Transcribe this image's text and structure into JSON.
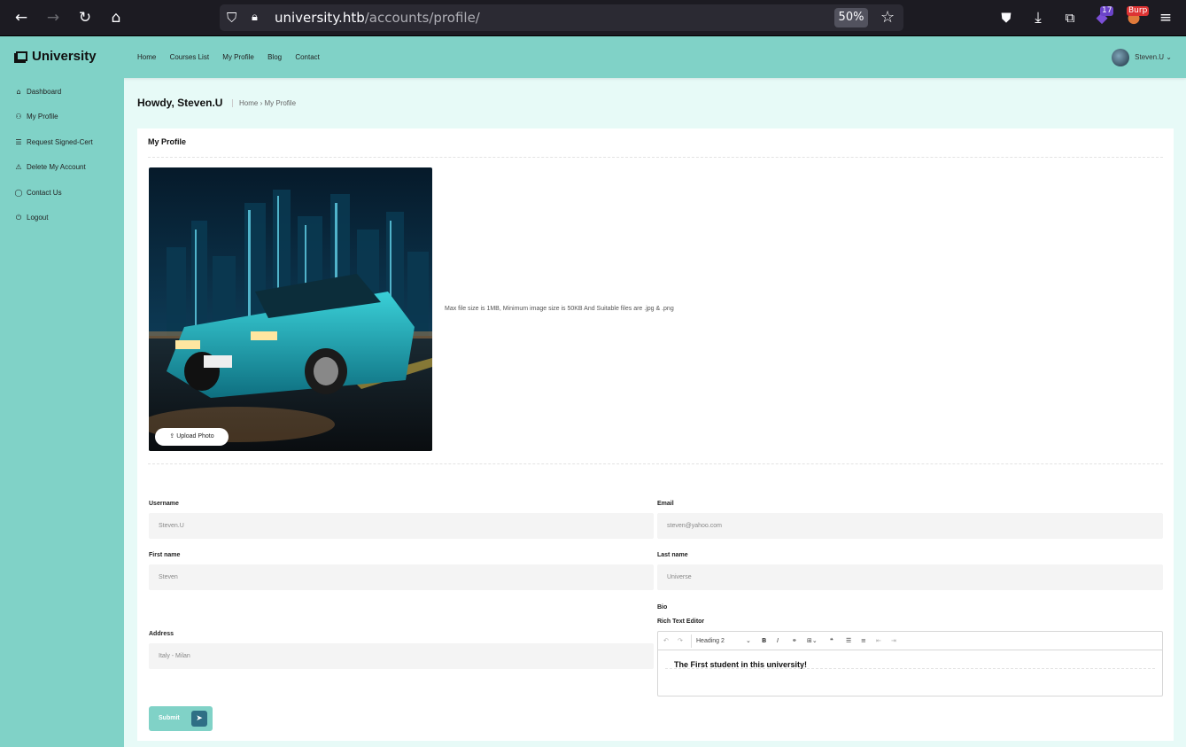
{
  "browser": {
    "url_host": "university.htb",
    "url_path": "/accounts/profile/",
    "zoom": "50%",
    "ext_badge_count": "17",
    "ext_badge_label": "Burp"
  },
  "header": {
    "logo": "University",
    "nav": [
      "Home",
      "Courses List",
      "My Profile",
      "Blog",
      "Contact"
    ],
    "user": "Steven.U"
  },
  "sidebar": {
    "items": [
      {
        "label": "Dashboard",
        "icon": "home-icon"
      },
      {
        "label": "My Profile",
        "icon": "user-icon"
      },
      {
        "label": "Request Signed-Cert",
        "icon": "document-icon"
      },
      {
        "label": "Delete My Account",
        "icon": "warning-icon"
      },
      {
        "label": "Contact Us",
        "icon": "chat-icon"
      },
      {
        "label": "Logout",
        "icon": "logout-icon"
      }
    ]
  },
  "page": {
    "greeting": "Howdy, Steven.U",
    "breadcrumb": [
      "Home",
      "My Profile"
    ]
  },
  "profile": {
    "card_title": "My Profile",
    "upload_label": "Upload Photo",
    "file_info": "Max file size is 1MB, Minimum image size is 50KB And Suitable files are .jpg & .png",
    "fields": {
      "username": {
        "label": "Username",
        "value": "Steven.U"
      },
      "email": {
        "label": "Email",
        "value": "steven@yahoo.com"
      },
      "first_name": {
        "label": "First name",
        "value": "Steven"
      },
      "last_name": {
        "label": "Last name",
        "value": "Universe"
      },
      "address": {
        "label": "Address",
        "value": "Italy - Milan"
      }
    },
    "bio": {
      "label": "Bio",
      "editor_label": "Rich Text Editor",
      "heading_select": "Heading 2",
      "content": "The First student in this university!"
    },
    "submit_label": "Submit"
  },
  "colors": {
    "accent": "#80d2c7",
    "page_bg": "#e7faf7",
    "browser_bg": "#1c1b22"
  }
}
